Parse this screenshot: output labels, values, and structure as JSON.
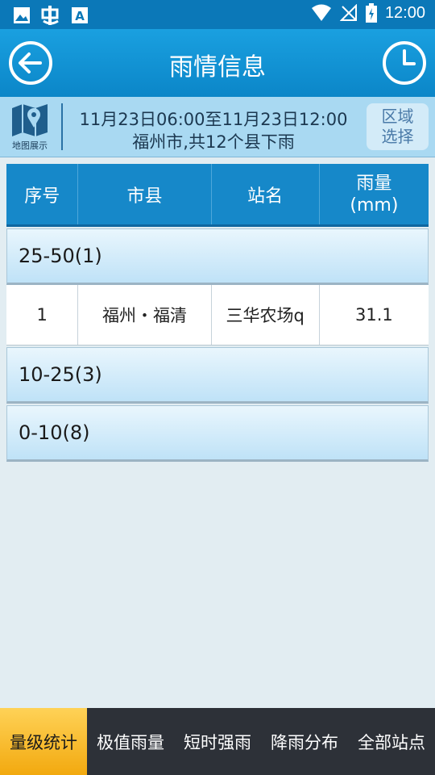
{
  "status_bar": {
    "time": "12:00",
    "left_icons": [
      "image-icon",
      "bug-icon",
      "font-icon"
    ],
    "right_icons": [
      "wifi-icon",
      "no-signal-icon",
      "battery-icon"
    ]
  },
  "header": {
    "title": "雨情信息"
  },
  "info": {
    "map_label": "地图展示",
    "line1": "11月23日06:00至11月23日12:00",
    "line2": "福州市,共12个县下雨",
    "region_button_line1": "区域",
    "region_button_line2": "选择"
  },
  "table": {
    "headers": [
      "序号",
      "市县",
      "站名",
      "雨量\n(mm)"
    ],
    "groups": [
      {
        "label": "25-50(1)",
        "rows": [
          {
            "index": "1",
            "county": "福州・福清",
            "station": "三华农场q",
            "rain": "31.1"
          }
        ]
      },
      {
        "label": "10-25(3)",
        "rows": []
      },
      {
        "label": "0-10(8)",
        "rows": []
      }
    ]
  },
  "bottom_nav": {
    "items": [
      "量级统计",
      "极值雨量",
      "短时强雨",
      "降雨分布",
      "全部站点"
    ],
    "active_index": 0
  },
  "colors": {
    "primary": "#1688c9",
    "active_tab": "#f2a90f",
    "nav_bg": "#2d3138"
  }
}
